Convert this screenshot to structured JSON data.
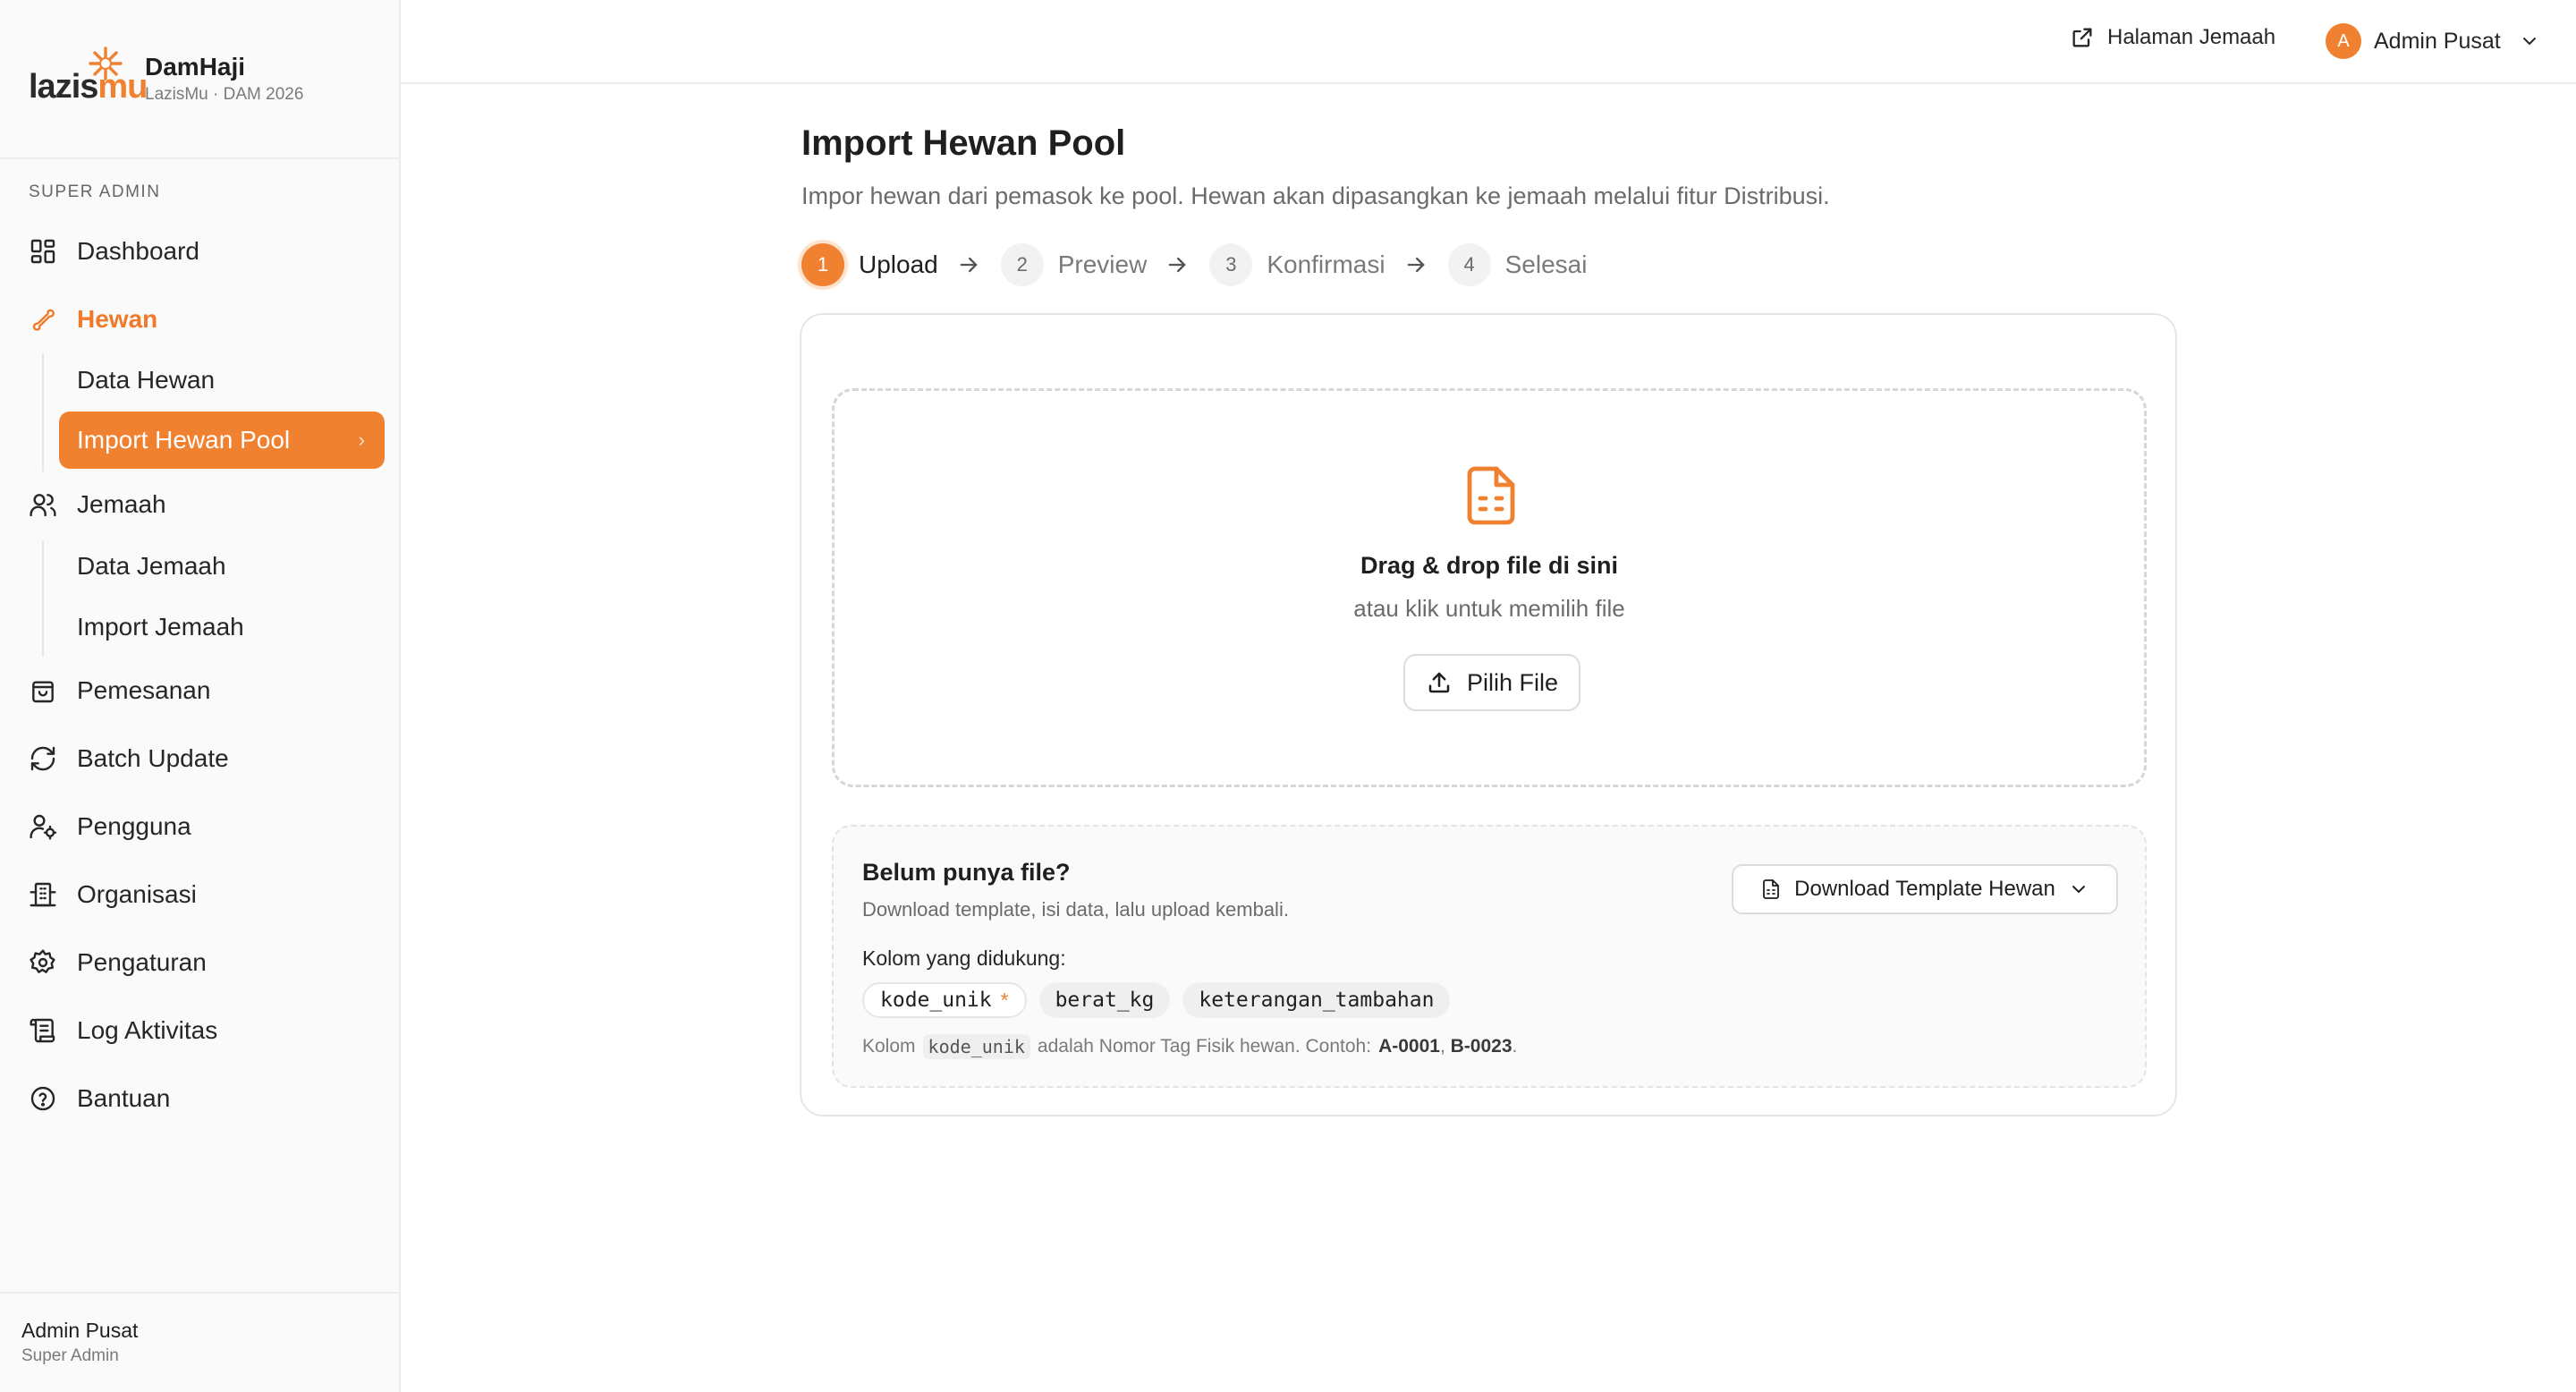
{
  "brand": {
    "logo_text_a": "lazis",
    "logo_text_b": "mu",
    "name": "DamHaji",
    "subtitle": "LazisMu · DAM 2026"
  },
  "sidebar": {
    "section_label": "SUPER ADMIN",
    "items": [
      {
        "label": "Dashboard",
        "icon": "dashboard-icon"
      },
      {
        "label": "Hewan",
        "icon": "bone-icon",
        "active": true,
        "children": [
          {
            "label": "Data Hewan"
          },
          {
            "label": "Import Hewan Pool",
            "selected": true
          }
        ]
      },
      {
        "label": "Jemaah",
        "icon": "users-icon",
        "children": [
          {
            "label": "Data Jemaah"
          },
          {
            "label": "Import Jemaah"
          }
        ]
      },
      {
        "label": "Pemesanan",
        "icon": "shopping-bag-icon"
      },
      {
        "label": "Batch Update",
        "icon": "refresh-icon"
      },
      {
        "label": "Pengguna",
        "icon": "user-cog-icon"
      },
      {
        "label": "Organisasi",
        "icon": "building-icon"
      },
      {
        "label": "Pengaturan",
        "icon": "gear-icon"
      },
      {
        "label": "Log Aktivitas",
        "icon": "scroll-icon"
      },
      {
        "label": "Bantuan",
        "icon": "help-circle-icon"
      }
    ],
    "footer": {
      "user_name": "Admin Pusat",
      "user_role": "Super Admin"
    }
  },
  "topbar": {
    "jemaah_link": "Halaman Jemaah",
    "user_initial": "A",
    "user_name": "Admin Pusat"
  },
  "main": {
    "title": "Import Hewan Pool",
    "description": "Impor hewan dari pemasok ke pool. Hewan akan dipasangkan ke jemaah melalui fitur Distribusi.",
    "steps": [
      {
        "num": "1",
        "label": "Upload",
        "current": true
      },
      {
        "num": "2",
        "label": "Preview"
      },
      {
        "num": "3",
        "label": "Konfirmasi"
      },
      {
        "num": "4",
        "label": "Selesai"
      }
    ],
    "dropzone": {
      "title": "Drag & drop file di sini",
      "subtitle": "atau klik untuk memilih file",
      "button": "Pilih File"
    },
    "template": {
      "title": "Belum punya file?",
      "subtitle": "Download template, isi data, lalu upload kembali.",
      "download_button": "Download Template Hewan",
      "columns_label": "Kolom yang didukung:",
      "columns": [
        {
          "name": "kode_unik",
          "required": true,
          "required_mark": "*"
        },
        {
          "name": "berat_kg"
        },
        {
          "name": "keterangan_tambahan"
        }
      ],
      "note_prefix": "Kolom",
      "note_code": "kode_unik",
      "note_middle": "adalah Nomor Tag Fisik hewan. Contoh:",
      "note_example_1": "A-0001",
      "note_sep": ",",
      "note_example_2": "B-0023",
      "note_end": "."
    }
  },
  "colors": {
    "accent": "#f08130",
    "border": "#e6e6e6",
    "muted_text": "#6b6b6b"
  }
}
